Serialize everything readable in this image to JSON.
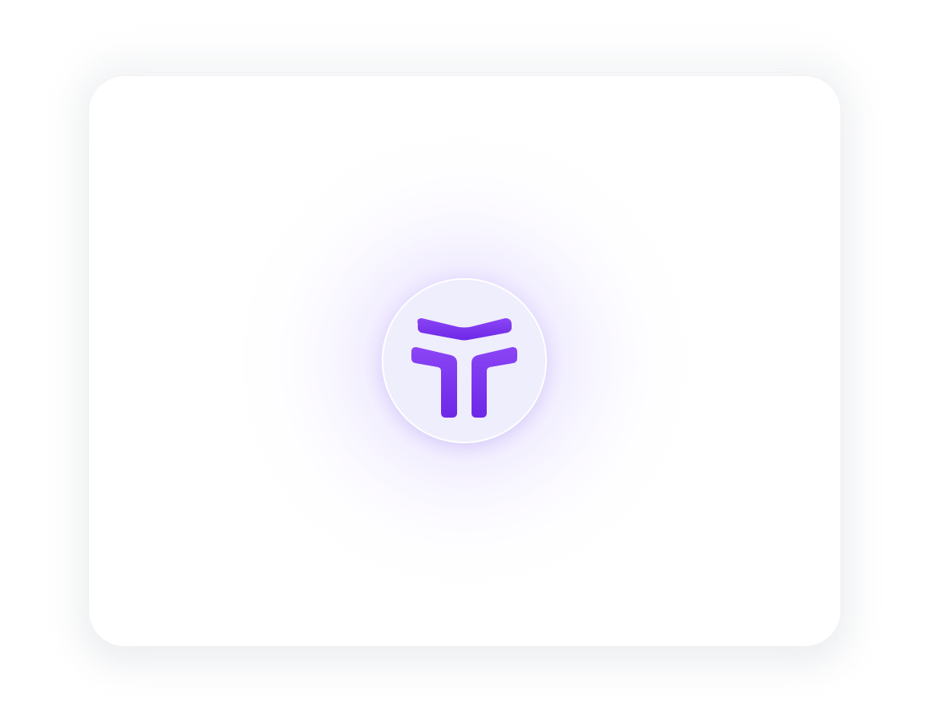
{
  "app": {
    "logo": {
      "icon": "brand-t-logo-icon",
      "accent_color": "#7c3aed",
      "badge_color": "#efeefc",
      "glow_color": "#9b6bff"
    },
    "card": {
      "background": "#ffffff"
    }
  }
}
